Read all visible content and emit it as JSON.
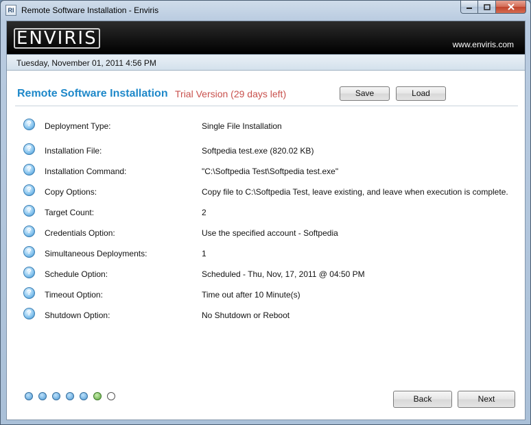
{
  "window": {
    "title": "Remote Software Installation - Enviris",
    "app_icon_text": "RI"
  },
  "header": {
    "logo_text": "ENVIRIS",
    "website": "www.enviris.com"
  },
  "date_bar": {
    "text": "Tuesday, November 01, 2011 4:56 PM"
  },
  "section": {
    "title": "Remote Software Installation",
    "trial": "Trial Version (29 days left)",
    "save_label": "Save",
    "load_label": "Load"
  },
  "rows": [
    {
      "label": "Deployment Type:",
      "value": "Single File Installation"
    },
    {
      "label": "Installation File:",
      "value": "Softpedia test.exe (820.02 KB)"
    },
    {
      "label": "Installation Command:",
      "value": "\"C:\\Softpedia Test\\Softpedia test.exe\""
    },
    {
      "label": "Copy Options:",
      "value": "Copy file to C:\\Softpedia Test, leave existing, and leave when execution is complete."
    },
    {
      "label": "Target Count:",
      "value": "2"
    },
    {
      "label": "Credentials Option:",
      "value": "Use the specified account - Softpedia"
    },
    {
      "label": "Simultaneous Deployments:",
      "value": "1"
    },
    {
      "label": "Schedule Option:",
      "value": "Scheduled - Thu, Nov, 17, 2011 @ 04:50 PM"
    },
    {
      "label": "Timeout Option:",
      "value": "Time out after 10 Minute(s)"
    },
    {
      "label": "Shutdown Option:",
      "value": "No Shutdown or Reboot"
    }
  ],
  "help_icon_glyph": "?",
  "wizard": {
    "total_steps": 7,
    "current_step": 6,
    "back_label": "Back",
    "next_label": "Next"
  },
  "colors": {
    "accent": "#1e88c9",
    "trial": "#c8504c",
    "completed_dot": "#4d9ad6",
    "current_dot": "#5aa53a"
  }
}
